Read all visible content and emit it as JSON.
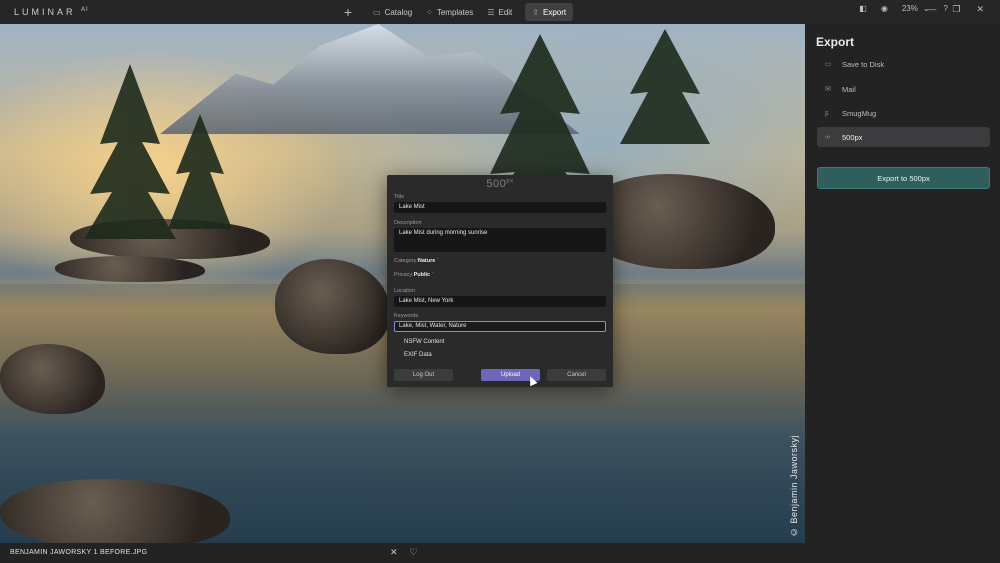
{
  "app": {
    "logo": "LUMINAR",
    "logo_sup": "AI"
  },
  "nav": {
    "add_label": "+",
    "items": [
      {
        "label": "Catalog",
        "icon": "catalog-icon",
        "glyph": "▭"
      },
      {
        "label": "Templates",
        "icon": "templates-icon",
        "glyph": "⁘"
      },
      {
        "label": "Edit",
        "icon": "edit-icon",
        "glyph": "☰"
      },
      {
        "label": "Export",
        "icon": "export-icon",
        "glyph": "⇪",
        "active": true
      }
    ]
  },
  "tools": {
    "compare_glyph": "◧",
    "view_glyph": "◉",
    "zoom": "23%",
    "zoom_chevron": "⌄",
    "help_glyph": "?"
  },
  "window": {
    "minimize": "—",
    "restore": "❐",
    "close": "✕"
  },
  "photo": {
    "credit": "© Benjamin Jaworskyj"
  },
  "bottom": {
    "filename": "BENJAMIN JAWORSKY 1 BEFORE.JPG",
    "close_glyph": "✕",
    "heart_glyph": "♡"
  },
  "panel": {
    "title": "Export",
    "options": [
      {
        "label": "Save to Disk",
        "icon": "folder-icon",
        "glyph": "▭"
      },
      {
        "label": "Mail",
        "icon": "mail-icon",
        "glyph": "✉"
      },
      {
        "label": "SmugMug",
        "icon": "smugmug-icon",
        "glyph": "ʂ"
      },
      {
        "label": "500px",
        "icon": "500px-icon",
        "glyph": "∞",
        "active": true
      }
    ],
    "export_button": "Export to 500px"
  },
  "dialog": {
    "logo": "500",
    "logo_sup": "px",
    "title_label": "Title",
    "title_value": "Lake Mist",
    "description_label": "Description",
    "description_value": "Lake Mist during morning sunrise",
    "category_label": "Category:",
    "category_value": "Nature",
    "privacy_label": "Privacy:",
    "privacy_value": "Public",
    "location_label": "Location",
    "location_value": "Lake Mist, New York",
    "keywords_label": "Keywords",
    "keywords_value": "Lake, Mist, Water, Nature",
    "nsfw_label": "NSFW Content",
    "exif_label": "EXIF Data",
    "logout_button": "Log Out",
    "upload_button": "Upload",
    "cancel_button": "Cancel"
  }
}
